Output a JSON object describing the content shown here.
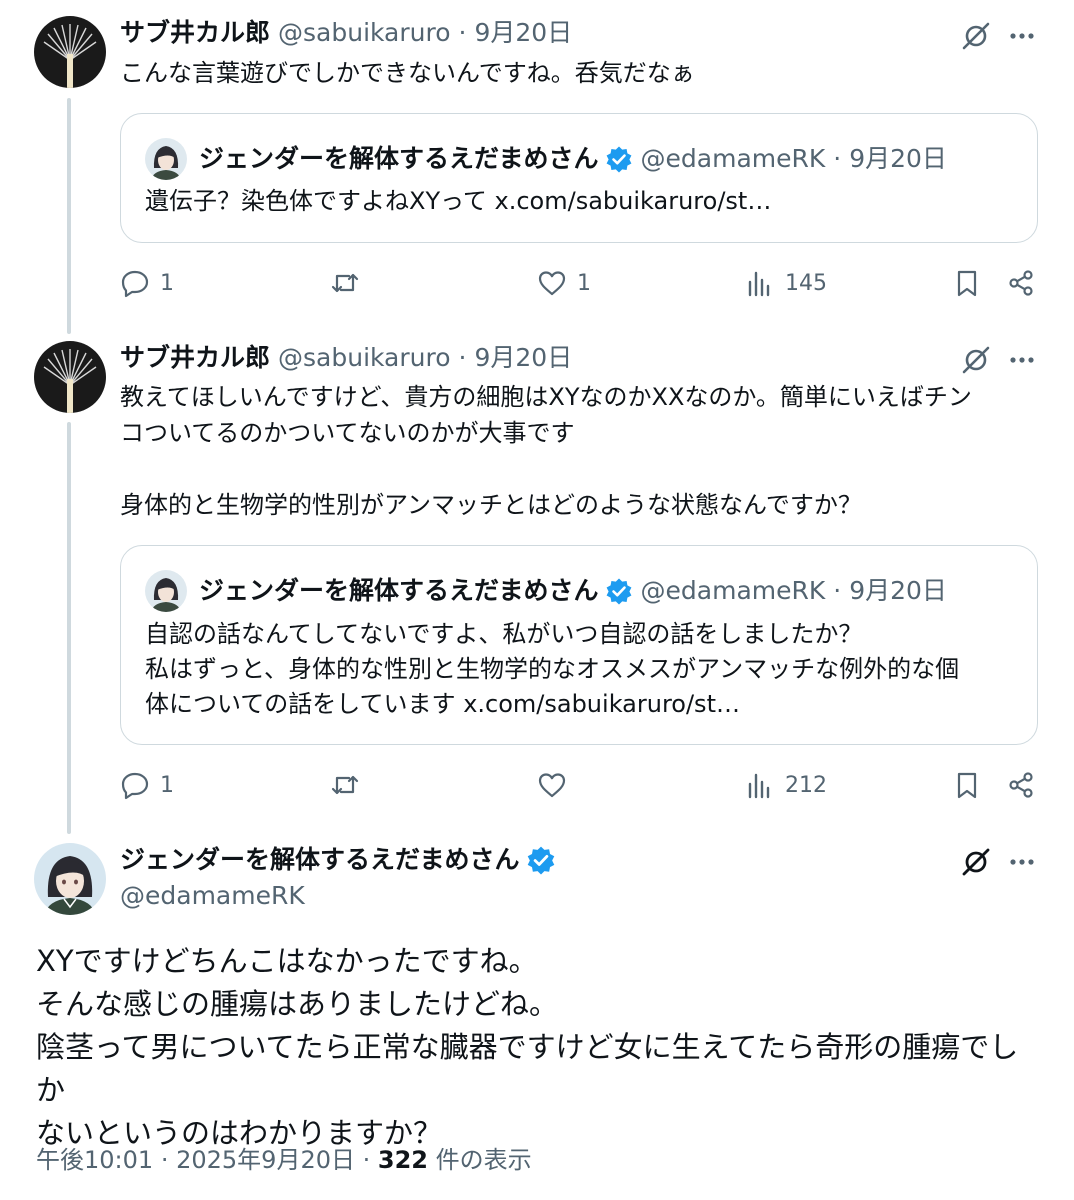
{
  "tweets": [
    {
      "author_name": "サブ井カル郎",
      "author_handle": "@sabuikaruro",
      "separator": "·",
      "date": "9月20日",
      "text": "こんな言葉遊びでしかできないんですね。呑気だなぁ",
      "quote": {
        "author_name": "ジェンダーを解体するえだまめさん",
        "author_handle": "@edamameRK",
        "separator": "·",
        "date": "9月20日",
        "text": "遺伝子？染色体ですよねXYって x.com/sabuikaruro/st…"
      },
      "actions": {
        "replies": "1",
        "retweets": "",
        "likes": "1",
        "views": "145"
      }
    },
    {
      "author_name": "サブ井カル郎",
      "author_handle": "@sabuikaruro",
      "separator": "·",
      "date": "9月20日",
      "text": "教えてほしいんですけど、貴方の細胞はXYなのかXXなのか。簡単にいえばチン\nコついてるのかついてないのかが大事です\n\n身体的と生物学的性別がアンマッチとはどのような状態なんですか？",
      "quote": {
        "author_name": "ジェンダーを解体するえだまめさん",
        "author_handle": "@edamameRK",
        "separator": "·",
        "date": "9月20日",
        "text": "自認の話なんてしてないですよ、私がいつ自認の話をしましたか？\n私はずっと、身体的な性別と生物学的なオスメスがアンマッチな例外的な個\n体についての話をしています x.com/sabuikaruro/st…"
      },
      "actions": {
        "replies": "1",
        "retweets": "",
        "likes": "",
        "views": "212"
      }
    }
  ],
  "main_tweet": {
    "author_name": "ジェンダーを解体するえだまめさん",
    "author_handle": "@edamameRK",
    "text": "XYですけどちんこはなかったですね。\nそんな感じの腫瘍はありましたけどね。\n陰茎って男についてたら正常な臓器ですけど女に生えてたら奇形の腫瘍でしか\nないというのはわかりますか？",
    "time": "午後10:01",
    "separator": "·",
    "full_date": "2025年9月20日",
    "view_count": "322",
    "view_suffix": "件の表示"
  },
  "icons": {
    "reply": "reply-icon",
    "retweet": "retweet-icon",
    "like": "heart-icon",
    "views": "views-icon",
    "bookmark": "bookmark-icon",
    "share": "share-icon",
    "grok": "grok-icon",
    "more": "more-icon",
    "verified": "verified-badge-icon"
  },
  "colors": {
    "text": "#0f1419",
    "secondary": "#536471",
    "border": "#cfd9de",
    "verified": "#1d9bf0"
  }
}
